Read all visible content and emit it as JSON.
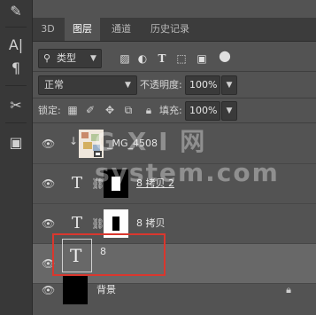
{
  "tabs": [
    {
      "label": "3D",
      "active": false
    },
    {
      "label": "图层",
      "active": true
    },
    {
      "label": "通道",
      "active": false
    },
    {
      "label": "历史记录",
      "active": false
    }
  ],
  "filter": {
    "label": "类型",
    "icons": [
      "image-filter-icon",
      "adjustment-filter-icon",
      "type-filter-icon",
      "shape-filter-icon",
      "smart-object-filter-icon",
      "toggle-filter-icon"
    ]
  },
  "blend": {
    "mode": "正常",
    "opacity_label": "不透明度:",
    "opacity_value": "100%"
  },
  "lock": {
    "label": "锁定:",
    "icons": [
      "lock-transparent-icon",
      "lock-image-icon",
      "lock-position-icon",
      "lock-artboard-icon",
      "lock-all-icon"
    ],
    "fill_label": "填充:",
    "fill_value": "100%"
  },
  "layers": [
    {
      "name": "_MG_4508",
      "type": "smart",
      "clipped": true,
      "selected": false
    },
    {
      "name": "8 拷贝 2",
      "type": "text-with-mask",
      "selected": false
    },
    {
      "name": "8 拷贝",
      "type": "text-with-mask",
      "selected": false
    },
    {
      "name": "8",
      "type": "text",
      "selected": true
    },
    {
      "name": "背景",
      "type": "background",
      "locked": true,
      "selected": false
    }
  ],
  "watermark": "G X I 网 system.com",
  "colors": {
    "panel_bg": "#535353",
    "tabbar_bg": "#3c3c3c",
    "selected_row": "#686868",
    "highlight_box": "#d9372e"
  }
}
